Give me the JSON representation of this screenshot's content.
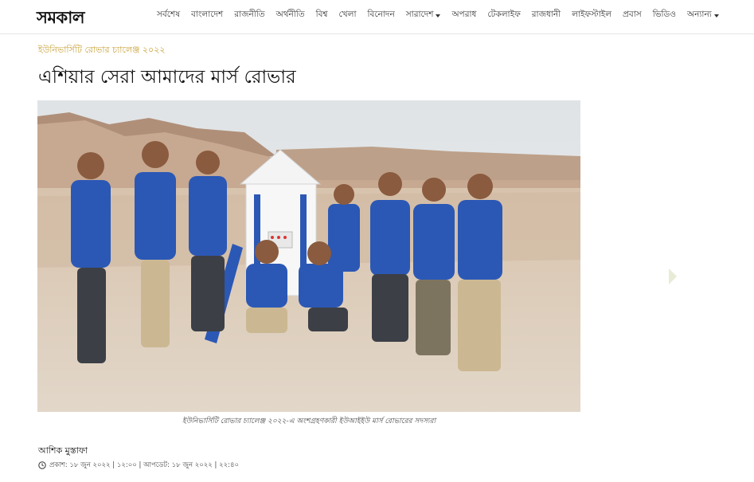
{
  "header": {
    "logo_text": "সমকাল",
    "nav": [
      {
        "label": "সর্বশেষ",
        "dropdown": false
      },
      {
        "label": "বাংলাদেশ",
        "dropdown": false
      },
      {
        "label": "রাজনীতি",
        "dropdown": false
      },
      {
        "label": "অর্থনীতি",
        "dropdown": false
      },
      {
        "label": "বিশ্ব",
        "dropdown": false
      },
      {
        "label": "খেলা",
        "dropdown": false
      },
      {
        "label": "বিনোদন",
        "dropdown": false
      },
      {
        "label": "সারাদেশ",
        "dropdown": true
      },
      {
        "label": "অপরাধ",
        "dropdown": false
      },
      {
        "label": "টেকলাইফ",
        "dropdown": false
      },
      {
        "label": "রাজধানী",
        "dropdown": false
      },
      {
        "label": "লাইফস্টাইল",
        "dropdown": false
      },
      {
        "label": "প্রবাস",
        "dropdown": false
      },
      {
        "label": "ভিডিও",
        "dropdown": false
      },
      {
        "label": "অন্যান্য",
        "dropdown": true
      }
    ]
  },
  "article": {
    "kicker": "ইউনিভার্সিটি রোভার চ্যালেঞ্জ ২০২২",
    "headline": "এশিয়ার সেরা আমাদের মার্স রোভার",
    "caption": "ইউনিভার্সিটি রোভার চ্যালেঞ্জ ২০২২-এ অংশগ্রহণকারী ইউআইইউ মার্স রোভারের সদস্যরা",
    "author": "আশিক মুস্তাফা",
    "dateline": "প্রকাশ: ১৮ জুন ২০২২ | ১২:০০ | আপডেট: ১৮ জুন ২০২২ | ২২:৪০"
  },
  "colors": {
    "kicker": "#c8a23a",
    "jersey": "#2b58b5",
    "desert": "#d9cbb8"
  }
}
